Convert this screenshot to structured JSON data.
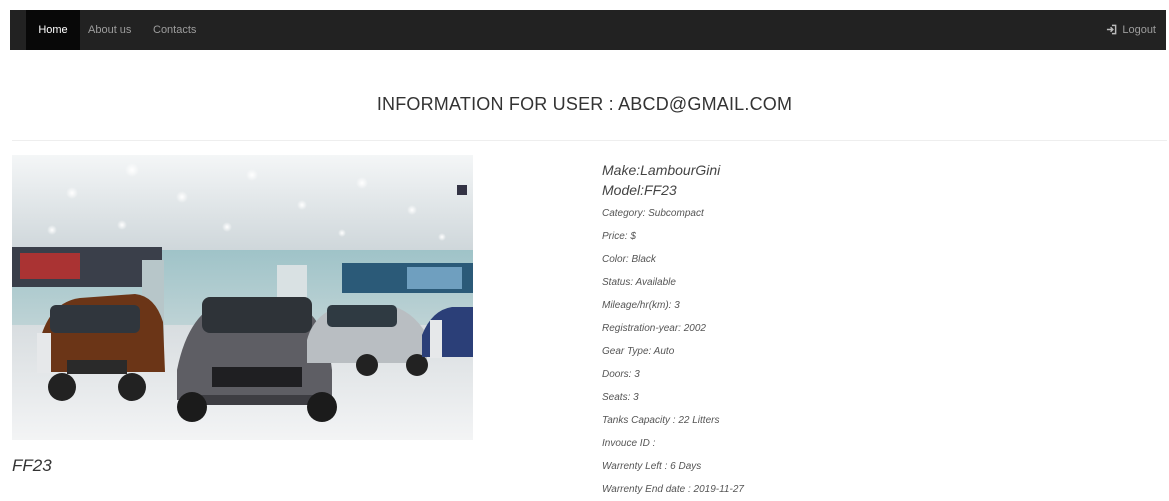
{
  "nav": {
    "home": "Home",
    "about": "About us",
    "contacts": "Contacts",
    "logout": "Logout",
    "logout_icon": "sign-out-icon"
  },
  "page": {
    "title": "INFORMATION FOR USER : ABCD@GMAIL.COM"
  },
  "car": {
    "caption": "FF23",
    "make": "Make:LambourGini",
    "model": "Model:FF23",
    "fields": [
      "Category: Subcompact",
      "Price: $",
      "Color: Black",
      "Status: Available",
      "Mileage/hr(km): 3",
      "Registration-year: 2002",
      "Gear Type: Auto",
      "Doors: 3",
      "Seats: 3",
      "Tanks Capacity : 22 Litters",
      "Invouce ID :",
      "Warrenty Left : 6 Days",
      "Warrenty End date : 2019-11-27"
    ]
  },
  "colors": {
    "navbar": "#222222",
    "nav_active": "#080808",
    "nav_text": "#9d9d9d"
  }
}
